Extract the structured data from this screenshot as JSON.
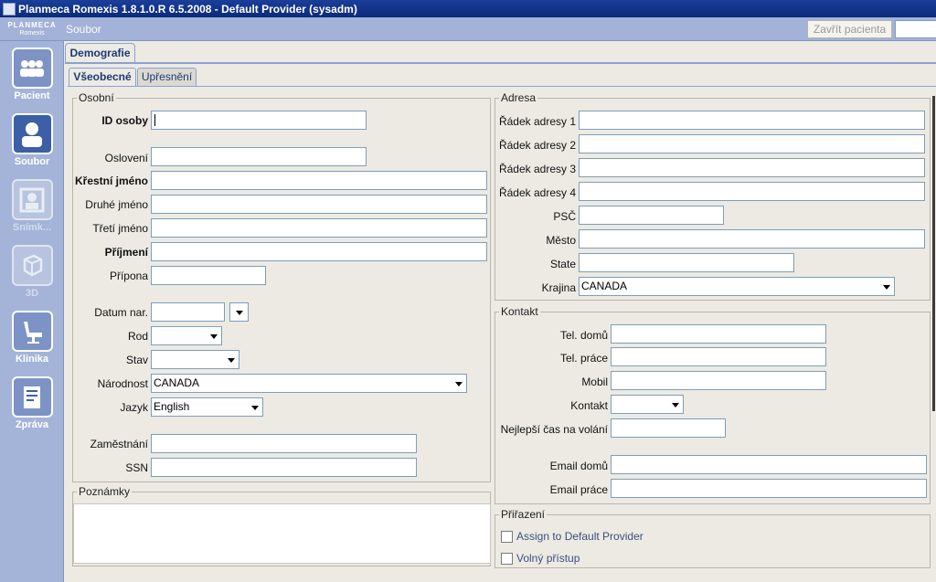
{
  "window": {
    "title": "Planmeca Romexis 1.8.1.0.R  6.5.2008 - Default Provider (sysadm)"
  },
  "logo": {
    "brand": "PLANMECA",
    "product": "Romexis"
  },
  "menubar": {
    "menu_label": "Soubor",
    "close_patient_label": "Zavřít pacienta"
  },
  "sidebar": {
    "items": [
      {
        "label": "Pacient",
        "icon": "patients-icon",
        "state": "normal"
      },
      {
        "label": "Soubor",
        "icon": "patient-file-icon",
        "state": "active"
      },
      {
        "label": "Snímk...",
        "icon": "imaging-icon",
        "state": "disabled"
      },
      {
        "label": "3D",
        "icon": "3d-cube-icon",
        "state": "disabled"
      },
      {
        "label": "Klinika",
        "icon": "dental-chair-icon",
        "state": "normal"
      },
      {
        "label": "Zpráva",
        "icon": "report-icon",
        "state": "normal"
      }
    ]
  },
  "tabs": {
    "main": "Demografie",
    "sub": [
      "Všeobecné",
      "Upřesnění"
    ]
  },
  "personal": {
    "title": "Osobní",
    "id_label": "ID osoby",
    "salutation_label": "Oslovení",
    "first_name_label": "Křestní jméno",
    "second_name_label": "Druhé jméno",
    "third_name_label": "Třetí jméno",
    "surname_label": "Příjmení",
    "suffix_label": "Přípona",
    "dob_label": "Datum nar.",
    "gender_label": "Rod",
    "status_label": "Stav",
    "nationality_label": "Národnost",
    "nationality_value": "CANADA",
    "language_label": "Jazyk",
    "language_value": "English",
    "employment_label": "Zaměstnání",
    "ssn_label": "SSN"
  },
  "notes": {
    "title": "Poznámky"
  },
  "address": {
    "title": "Adresa",
    "line1_label": "Řádek adresy 1",
    "line2_label": "Řádek adresy 2",
    "line3_label": "Řádek adresy 3",
    "line4_label": "Řádek adresy 4",
    "zip_label": "PSČ",
    "city_label": "Město",
    "state_label": "State",
    "country_label": "Krajina",
    "country_value": "CANADA"
  },
  "contact": {
    "title": "Kontakt",
    "home_phone_label": "Tel. domů",
    "work_phone_label": "Tel. práce",
    "mobile_label": "Mobil",
    "contact_label": "Kontakt",
    "best_time_label": "Nejlepší čas na volání",
    "home_email_label": "Email domů",
    "work_email_label": "Email práce"
  },
  "assignment": {
    "title": "Přiřazení",
    "assign_label": "Assign to Default Provider",
    "free_access_label": "Volný přístup"
  },
  "colors": {
    "titlebar": "#0b2a7a",
    "sidebar": "#a4b4d9",
    "panel": "#eceae3",
    "input_border": "#7f9db9"
  }
}
